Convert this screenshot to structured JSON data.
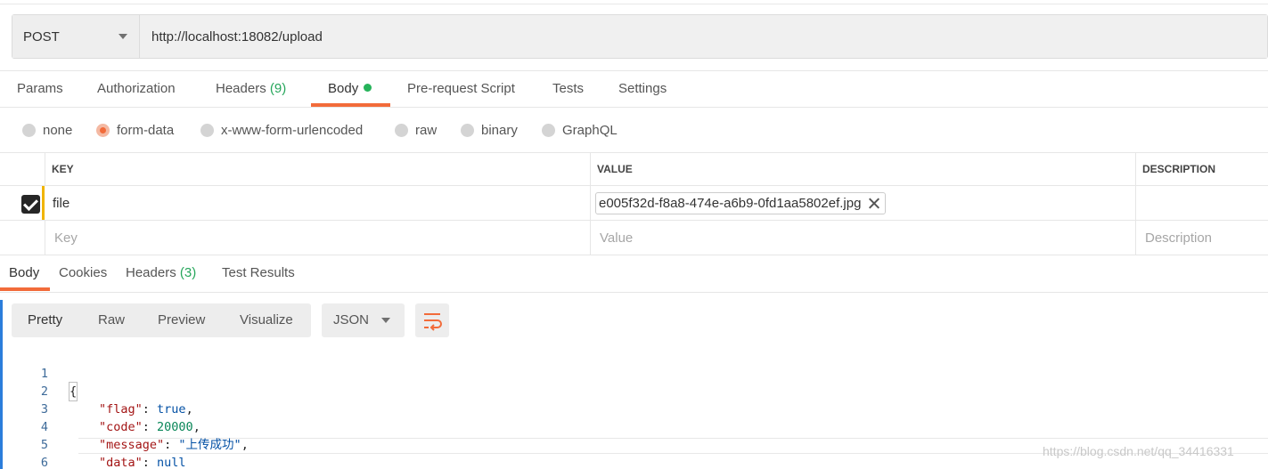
{
  "request": {
    "method": "POST",
    "url": "http://localhost:18082/upload"
  },
  "request_tabs": [
    {
      "label": "Params",
      "count": ""
    },
    {
      "label": "Authorization",
      "count": ""
    },
    {
      "label": "Headers",
      "count": "(9)"
    },
    {
      "label": "Body",
      "count": "",
      "active": true
    },
    {
      "label": "Pre-request Script",
      "count": ""
    },
    {
      "label": "Tests",
      "count": ""
    },
    {
      "label": "Settings",
      "count": ""
    }
  ],
  "body_types": [
    {
      "label": "none",
      "selected": false
    },
    {
      "label": "form-data",
      "selected": true
    },
    {
      "label": "x-www-form-urlencoded",
      "selected": false
    },
    {
      "label": "raw",
      "selected": false
    },
    {
      "label": "binary",
      "selected": false
    },
    {
      "label": "GraphQL",
      "selected": false
    }
  ],
  "form_table": {
    "headers": {
      "key": "KEY",
      "value": "VALUE",
      "description": "DESCRIPTION"
    },
    "rows": [
      {
        "checked": true,
        "key": "file",
        "value": "e005f32d-f8a8-474e-a6b9-0fd1aa5802ef.jpg",
        "description": ""
      }
    ],
    "placeholders": {
      "key": "Key",
      "value": "Value",
      "description": "Description"
    }
  },
  "response_tabs": [
    {
      "label": "Body",
      "count": "",
      "active": true
    },
    {
      "label": "Cookies",
      "count": ""
    },
    {
      "label": "Headers",
      "count": "(3)"
    },
    {
      "label": "Test Results",
      "count": ""
    }
  ],
  "view_modes": [
    "Pretty",
    "Raw",
    "Preview",
    "Visualize"
  ],
  "format": "JSON",
  "code_lines": [
    {
      "n": "1",
      "text": "{"
    },
    {
      "n": "2",
      "key": "\"flag\"",
      "value": "true",
      "kind": "bool",
      "trail": ","
    },
    {
      "n": "3",
      "key": "\"code\"",
      "value": "20000",
      "kind": "num",
      "trail": ","
    },
    {
      "n": "4",
      "key": "\"message\"",
      "value": "\"上传成功\"",
      "kind": "str",
      "trail": ","
    },
    {
      "n": "5",
      "key": "\"data\"",
      "value": "null",
      "kind": "bool",
      "trail": ""
    },
    {
      "n": "6",
      "text": "}"
    }
  ],
  "watermark": "https://blog.csdn.net/qq_34416331",
  "colors": {
    "accent": "#f26b3a",
    "count_green": "#26a65b",
    "active_dot": "#26b35a",
    "marker_yellow": "#f0b400",
    "line_number_blue": "#3d6a99"
  },
  "icons": {
    "method_dropdown": "chevron-down-icon",
    "file_remove": "close-icon",
    "wrap_lines": "wrap-lines-icon",
    "row_checkbox": "checkbox-checked-icon"
  }
}
